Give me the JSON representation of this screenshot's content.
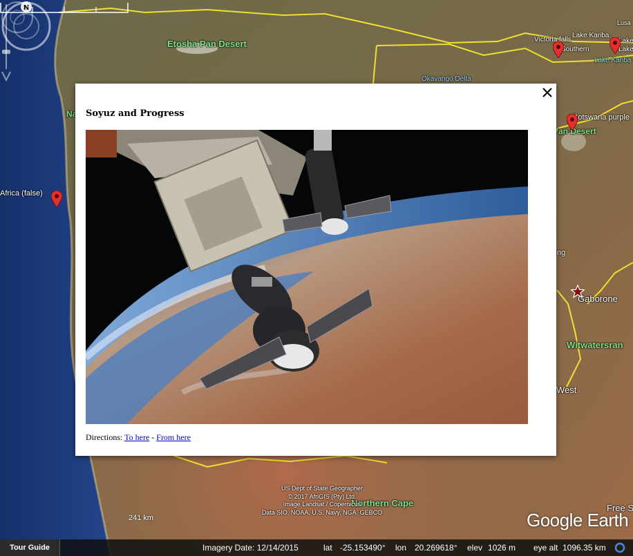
{
  "map": {
    "labels": {
      "etosha": "Etosha Pan Desert",
      "okavango": "Okavango Delta",
      "victoria_falls": "Victoria falls",
      "southern": "Southern",
      "lake_kariba_1": "Lake Kariba",
      "lake_kariba_2": "Lake Kariba",
      "lake_k": "Lake K",
      "lake_kar": "Lake Kar",
      "lusaka": "Lusa",
      "botswana": "Botswana purple",
      "pan_desert": "Pan Desert",
      "africa_false": "Africa (false)",
      "na": "Na",
      "ng": "ng",
      "gaborone": "Gaborone",
      "witwatersrand": "Witwatersran",
      "west": "West",
      "northern_cape": "Northern Cape",
      "free_s": "Free S"
    },
    "scale_label": "241 km",
    "compass_north": "N",
    "copyright_lines": [
      "US Dept of State Geographer",
      "© 2017 AfriGIS (Pty) Ltd.",
      "Image Landsat / Copernicus",
      "Data SIO, NOAA, U.S. Navy, NGA, GEBCO"
    ],
    "logo": "Google Earth"
  },
  "statusbar": {
    "tour_guide": "Tour Guide",
    "imagery_date": "Imagery Date: 12/14/2015",
    "lat_label": "lat",
    "lat_value": "-25.153490°",
    "lon_label": "lon",
    "lon_value": "20.269618°",
    "elev_label": "elev",
    "elev_value": "1026 m",
    "eye_label": "eye alt",
    "eye_value": "1096.35 km"
  },
  "balloon": {
    "title": "Soyuz and Progress",
    "directions_label": "Directions:",
    "to_here": "To here",
    "separator": " - ",
    "from_here": "From here"
  },
  "colors": {
    "border_line": "#f0e030",
    "ocean": "#1e3a78",
    "link": "#0000cc"
  }
}
